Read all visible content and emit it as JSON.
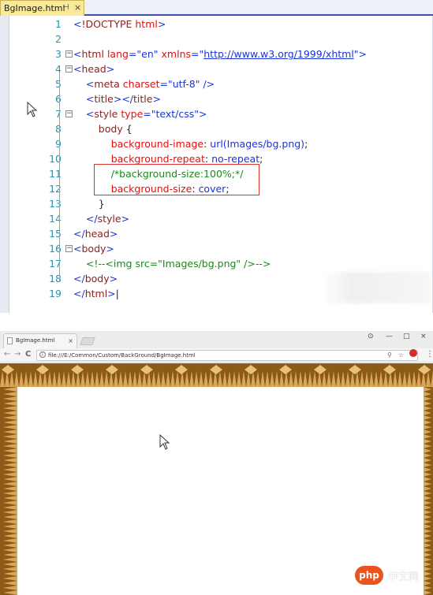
{
  "editor": {
    "file_tab": "BgImage.html",
    "pin_icon": "pin-icon",
    "close_icon": "close-icon",
    "lines": [
      {
        "num": "1",
        "tokens": [
          {
            "c": "tk-br",
            "t": "<"
          },
          {
            "c": "tk-tag",
            "t": "!DOCTYPE "
          },
          {
            "c": "tk-attr",
            "t": "html"
          },
          {
            "c": "tk-br",
            "t": ">"
          }
        ]
      },
      {
        "num": "2",
        "tokens": []
      },
      {
        "num": "3",
        "tokens": [
          {
            "c": "tk-br",
            "t": "<"
          },
          {
            "c": "tk-tag",
            "t": "html "
          },
          {
            "c": "tk-attr",
            "t": "lang"
          },
          {
            "c": "tk-br",
            "t": "=\""
          },
          {
            "c": "tk-val",
            "t": "en"
          },
          {
            "c": "tk-br",
            "t": "\" "
          },
          {
            "c": "tk-attr",
            "t": "xmlns"
          },
          {
            "c": "tk-br",
            "t": "=\""
          },
          {
            "c": "tk-url",
            "t": "http://www.w3.org/1999/xhtml"
          },
          {
            "c": "tk-br",
            "t": "\">"
          }
        ]
      },
      {
        "num": "4",
        "tokens": [
          {
            "c": "tk-br",
            "t": "<"
          },
          {
            "c": "tk-tag",
            "t": "head"
          },
          {
            "c": "tk-br",
            "t": ">"
          }
        ]
      },
      {
        "num": "5",
        "tokens": [
          {
            "c": "tk-plain",
            "t": "    "
          },
          {
            "c": "tk-br",
            "t": "<"
          },
          {
            "c": "tk-tag",
            "t": "meta "
          },
          {
            "c": "tk-attr",
            "t": "charset"
          },
          {
            "c": "tk-br",
            "t": "=\""
          },
          {
            "c": "tk-val",
            "t": "utf-8"
          },
          {
            "c": "tk-br",
            "t": "\" />"
          }
        ]
      },
      {
        "num": "6",
        "tokens": [
          {
            "c": "tk-plain",
            "t": "    "
          },
          {
            "c": "tk-br",
            "t": "<"
          },
          {
            "c": "tk-tag",
            "t": "title"
          },
          {
            "c": "tk-br",
            "t": "></"
          },
          {
            "c": "tk-tag",
            "t": "title"
          },
          {
            "c": "tk-br",
            "t": ">"
          }
        ]
      },
      {
        "num": "7",
        "tokens": [
          {
            "c": "tk-plain",
            "t": "    "
          },
          {
            "c": "tk-br",
            "t": "<"
          },
          {
            "c": "tk-tag",
            "t": "style "
          },
          {
            "c": "tk-attr",
            "t": "type"
          },
          {
            "c": "tk-br",
            "t": "=\""
          },
          {
            "c": "tk-val",
            "t": "text/css"
          },
          {
            "c": "tk-br",
            "t": "\">"
          }
        ]
      },
      {
        "num": "8",
        "tokens": [
          {
            "c": "tk-plain",
            "t": "        "
          },
          {
            "c": "tk-tag",
            "t": "body "
          },
          {
            "c": "tk-plain",
            "t": "{"
          }
        ]
      },
      {
        "num": "9",
        "tokens": [
          {
            "c": "tk-plain",
            "t": "            "
          },
          {
            "c": "tk-prop",
            "t": "background-image"
          },
          {
            "c": "tk-plain",
            "t": ": "
          },
          {
            "c": "tk-pval",
            "t": "url(Images/bg.png)"
          },
          {
            "c": "tk-plain",
            "t": ";"
          }
        ]
      },
      {
        "num": "10",
        "tokens": [
          {
            "c": "tk-plain",
            "t": "            "
          },
          {
            "c": "tk-prop",
            "t": "background-repeat"
          },
          {
            "c": "tk-plain",
            "t": ": "
          },
          {
            "c": "tk-pval",
            "t": "no-repeat"
          },
          {
            "c": "tk-plain",
            "t": ";"
          }
        ]
      },
      {
        "num": "11",
        "tokens": [
          {
            "c": "tk-plain",
            "t": "            "
          },
          {
            "c": "tk-cmt",
            "t": "/*background-size:100%;*/"
          }
        ]
      },
      {
        "num": "12",
        "tokens": [
          {
            "c": "tk-plain",
            "t": "            "
          },
          {
            "c": "tk-prop",
            "t": "background-size"
          },
          {
            "c": "tk-plain",
            "t": ": "
          },
          {
            "c": "tk-pval",
            "t": "cover"
          },
          {
            "c": "tk-plain",
            "t": ";"
          }
        ]
      },
      {
        "num": "13",
        "tokens": [
          {
            "c": "tk-plain",
            "t": "        }"
          }
        ]
      },
      {
        "num": "14",
        "tokens": [
          {
            "c": "tk-plain",
            "t": "    "
          },
          {
            "c": "tk-br",
            "t": "</"
          },
          {
            "c": "tk-tag",
            "t": "style"
          },
          {
            "c": "tk-br",
            "t": ">"
          }
        ]
      },
      {
        "num": "15",
        "tokens": [
          {
            "c": "tk-br",
            "t": "</"
          },
          {
            "c": "tk-tag",
            "t": "head"
          },
          {
            "c": "tk-br",
            "t": ">"
          }
        ]
      },
      {
        "num": "16",
        "tokens": [
          {
            "c": "tk-br",
            "t": "<"
          },
          {
            "c": "tk-tag",
            "t": "body"
          },
          {
            "c": "tk-br",
            "t": ">"
          }
        ]
      },
      {
        "num": "17",
        "tokens": [
          {
            "c": "tk-plain",
            "t": "    "
          },
          {
            "c": "tk-cmt",
            "t": "<!--<img src=\"Images/bg.png\" />-->"
          }
        ]
      },
      {
        "num": "18",
        "tokens": [
          {
            "c": "tk-br",
            "t": "</"
          },
          {
            "c": "tk-tag",
            "t": "body"
          },
          {
            "c": "tk-br",
            "t": ">"
          }
        ]
      },
      {
        "num": "19",
        "tokens": [
          {
            "c": "tk-br",
            "t": "</"
          },
          {
            "c": "tk-tag",
            "t": "html"
          },
          {
            "c": "tk-br",
            "t": ">"
          },
          {
            "c": "tk-plain",
            "t": "|"
          }
        ]
      }
    ],
    "fold_lines": [
      "3",
      "4",
      "7",
      "16"
    ]
  },
  "browser": {
    "tab_title": "BgImage.html",
    "tab_close": "×",
    "window_controls": [
      "⊙",
      "—",
      "□",
      "×"
    ],
    "nav": {
      "back": "←",
      "forward": "→",
      "reload": "C"
    },
    "address": "file:///E:/Common/Custom/BackGround/BgImage.html",
    "info_glyph": "i",
    "omni_right": [
      "⚲",
      "☆"
    ],
    "menu_glyph": "⋮"
  },
  "watermark": {
    "logo": "php",
    "text": "中文网"
  },
  "colors": {
    "frame": "#8b5a16",
    "frame_light": "#d9a75a",
    "tab_yellow": "#fbe99a",
    "accent_blue": "#3f51a8"
  }
}
